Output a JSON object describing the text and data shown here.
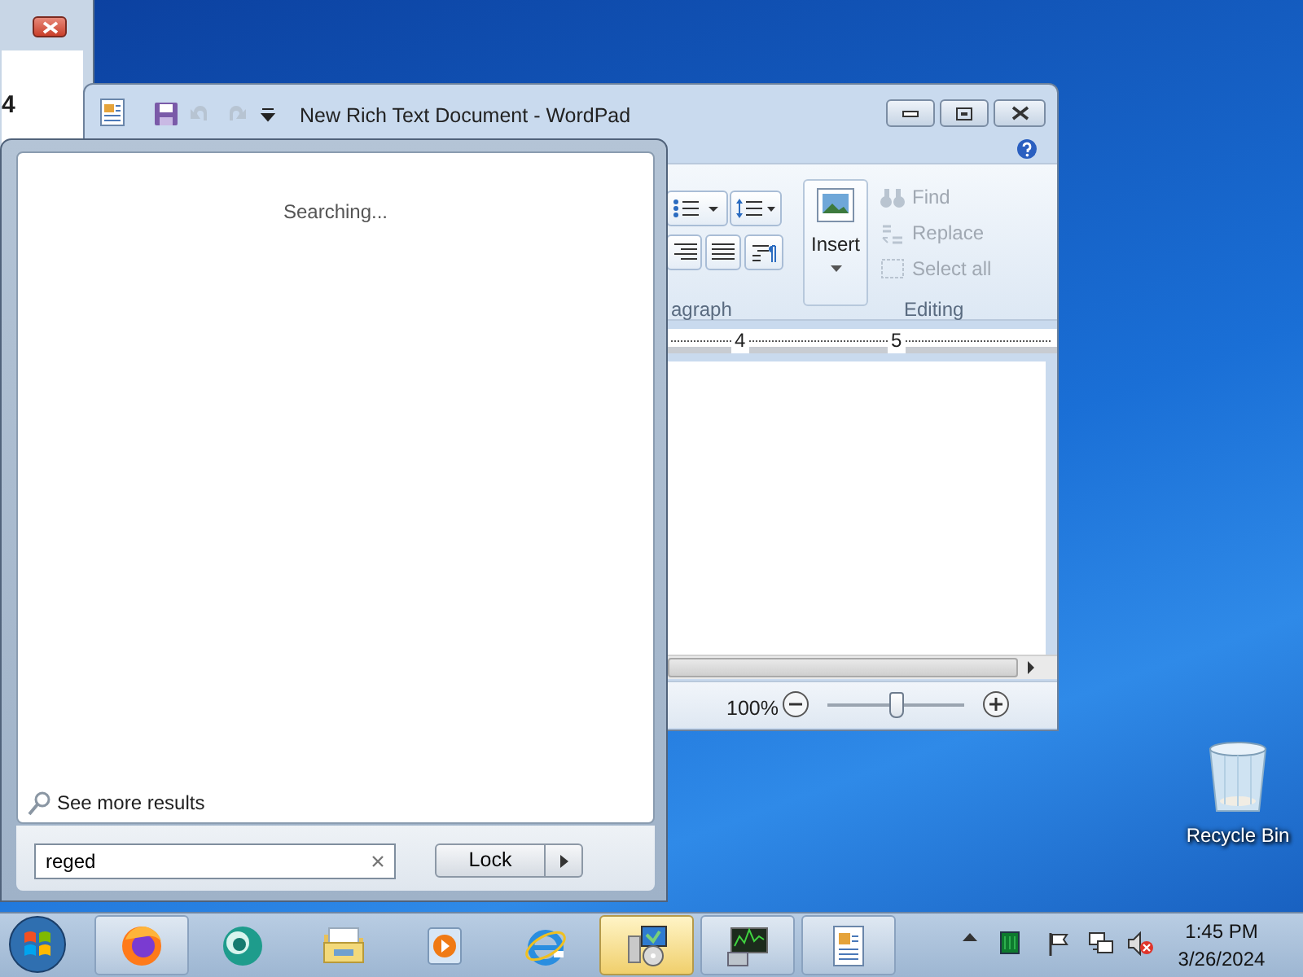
{
  "back_window": {
    "text": "4"
  },
  "wordpad": {
    "title": "New Rich Text Document - WordPad",
    "ribbon": {
      "paragraph_group": "agraph",
      "insert": "Insert",
      "editing_group": "Editing",
      "editing_items": [
        {
          "kind": "find",
          "label": "Find",
          "disabled": true
        },
        {
          "kind": "replace",
          "label": "Replace",
          "disabled": true
        },
        {
          "kind": "select",
          "label": "Select all",
          "disabled": true
        }
      ]
    },
    "ruler_numbers": [
      "4",
      "5"
    ],
    "zoom": {
      "reading": "100%",
      "level": 0.5
    }
  },
  "start_menu": {
    "status": "Searching...",
    "see_more": "See more results",
    "search": {
      "value": "reged"
    },
    "power_button": "Lock"
  },
  "taskbar": {
    "items": [
      {
        "kind": "firefox",
        "running": true,
        "selected": false
      },
      {
        "kind": "orb-app",
        "running": false,
        "selected": false
      },
      {
        "kind": "explorer",
        "running": false,
        "selected": false
      },
      {
        "kind": "media",
        "running": false,
        "selected": false
      },
      {
        "kind": "browser",
        "running": false,
        "selected": false
      },
      {
        "kind": "installer",
        "running": true,
        "selected": true
      },
      {
        "kind": "monitor",
        "running": true,
        "selected": false
      },
      {
        "kind": "wordpad",
        "running": true,
        "selected": false
      }
    ],
    "clock": {
      "time": "1:45 PM",
      "date": "3/26/2024"
    }
  },
  "desktop_icons": [
    {
      "label": "Recycle Bin"
    }
  ]
}
